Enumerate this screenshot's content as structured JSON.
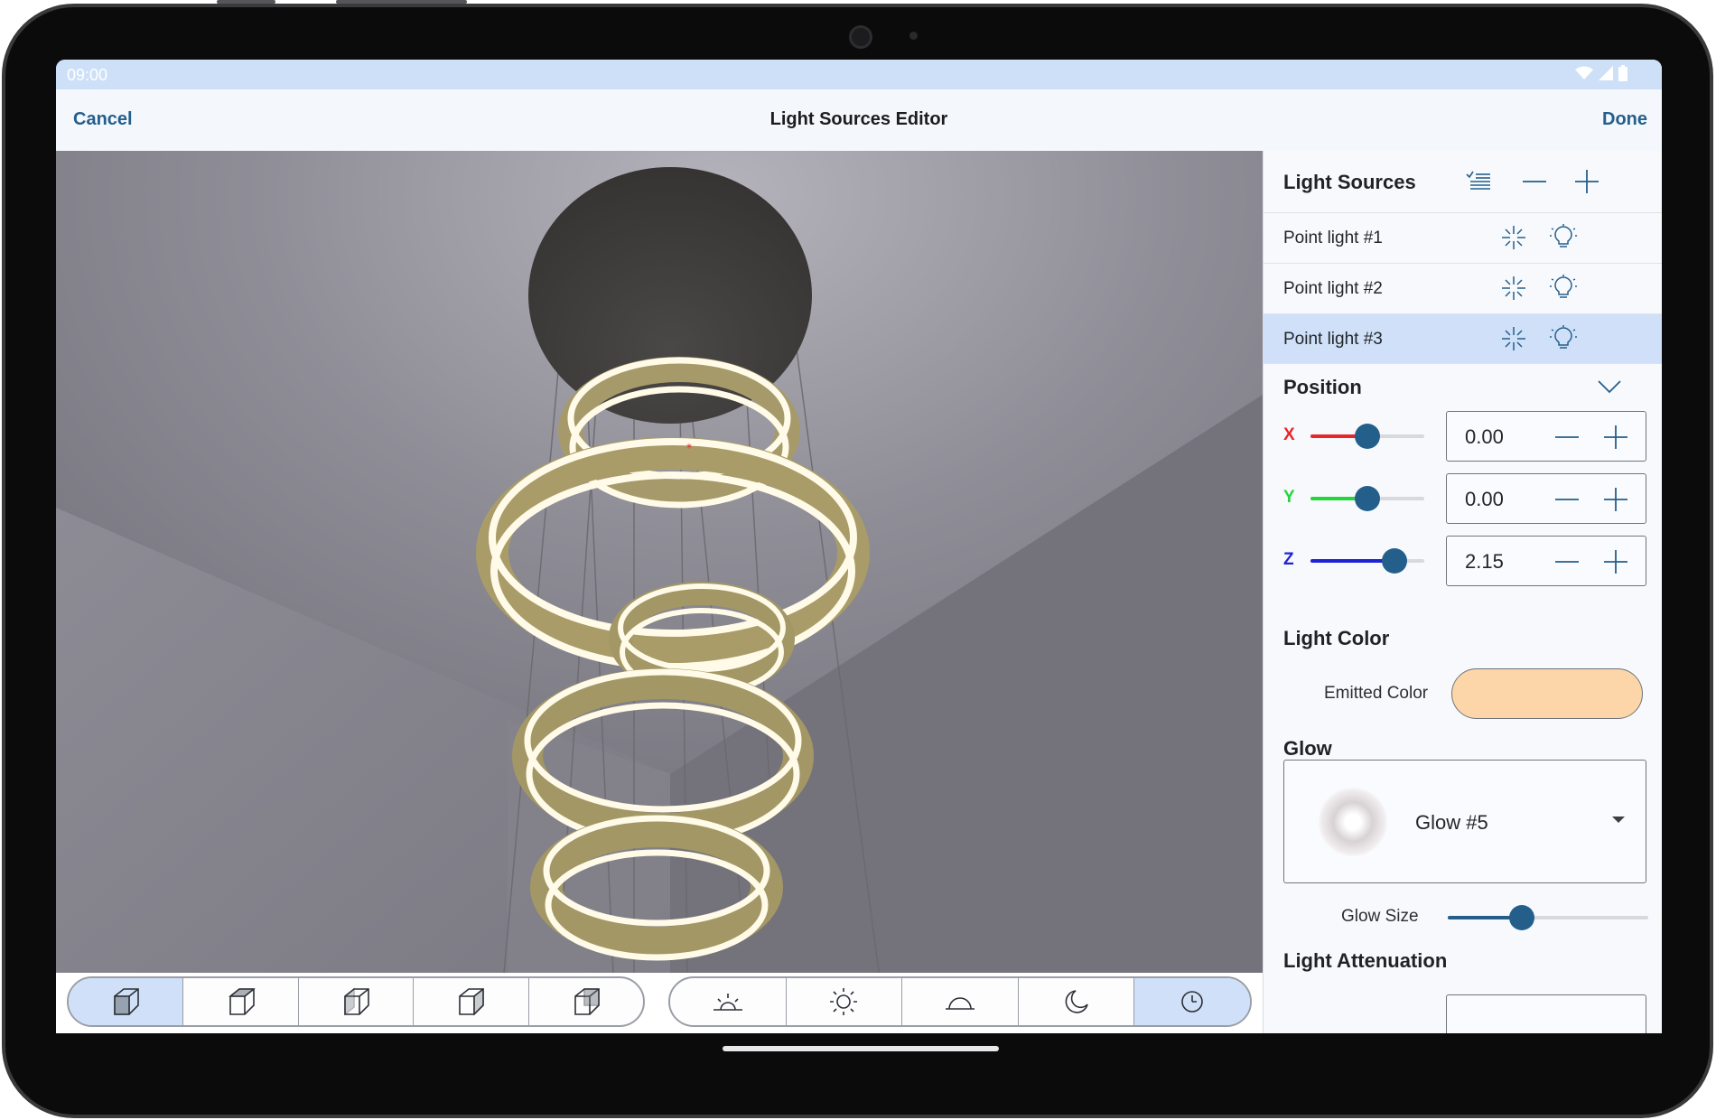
{
  "status_bar": {
    "time": "09:00"
  },
  "app_bar": {
    "cancel_label": "Cancel",
    "title": "Light Sources Editor",
    "done_label": "Done"
  },
  "toolbar": {
    "view_icons": [
      "front-view-cube-icon",
      "top-view-cube-icon",
      "side-view-cube-icon",
      "right-view-cube-icon",
      "back-view-cube-icon"
    ],
    "lighting_icons": [
      "sunrise-icon",
      "sun-icon",
      "dome-light-icon",
      "moon-icon",
      "clock-icon"
    ],
    "active_view": 0,
    "active_lighting": 4
  },
  "panel": {
    "light_sources": {
      "heading": "Light Sources",
      "items": [
        {
          "label": "Point light #1",
          "selected": false
        },
        {
          "label": "Point light #2",
          "selected": false
        },
        {
          "label": "Point light #3",
          "selected": true
        }
      ]
    },
    "position": {
      "heading": "Position",
      "axes": [
        {
          "label": "X",
          "value": "0.00",
          "slider_fraction": 0.5,
          "color": "#e8262a"
        },
        {
          "label": "Y",
          "value": "0.00",
          "slider_fraction": 0.5,
          "color": "#26d43c"
        },
        {
          "label": "Z",
          "value": "2.15",
          "slider_fraction": 0.74,
          "color": "#1f23d6"
        }
      ]
    },
    "light_color": {
      "heading": "Light Color",
      "emitted_label": "Emitted Color",
      "emitted_color": "#fcd6a8"
    },
    "glow": {
      "heading": "Glow",
      "selected": "Glow #5",
      "size_label": "Glow Size",
      "size_fraction": 0.37
    },
    "attenuation": {
      "heading": "Light Attenuation"
    }
  },
  "colors": {
    "accent": "#245f8c",
    "selected_row": "#cfe0f8"
  }
}
